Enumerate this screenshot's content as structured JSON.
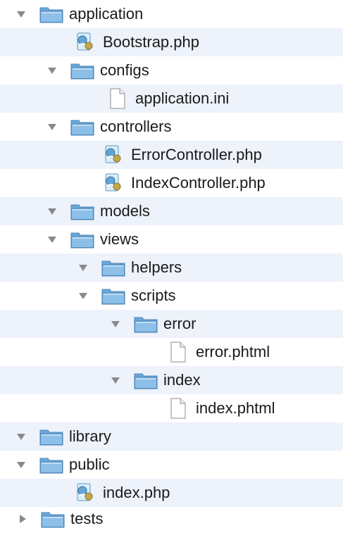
{
  "tree": {
    "rows": [
      {
        "label": "application",
        "type": "folder",
        "expanded": true,
        "depth": 0
      },
      {
        "label": "Bootstrap.php",
        "type": "php",
        "depth": 1
      },
      {
        "label": "configs",
        "type": "folder",
        "expanded": true,
        "depth": 1
      },
      {
        "label": "application.ini",
        "type": "file",
        "depth": 2
      },
      {
        "label": "controllers",
        "type": "folder",
        "expanded": true,
        "depth": 1
      },
      {
        "label": "ErrorController.php",
        "type": "php",
        "depth": 2
      },
      {
        "label": "IndexController.php",
        "type": "php",
        "depth": 2
      },
      {
        "label": "models",
        "type": "folder",
        "expanded": true,
        "depth": 1
      },
      {
        "label": "views",
        "type": "folder",
        "expanded": true,
        "depth": 1
      },
      {
        "label": "helpers",
        "type": "folder",
        "expanded": true,
        "depth": 2
      },
      {
        "label": "scripts",
        "type": "folder",
        "expanded": true,
        "depth": 2
      },
      {
        "label": "error",
        "type": "folder",
        "expanded": true,
        "depth": 3
      },
      {
        "label": "error.phtml",
        "type": "file",
        "depth": 4
      },
      {
        "label": "index",
        "type": "folder",
        "expanded": true,
        "depth": 3
      },
      {
        "label": "index.phtml",
        "type": "file",
        "depth": 4
      },
      {
        "label": "library",
        "type": "folder",
        "expanded": true,
        "depth": 0
      },
      {
        "label": "public",
        "type": "folder",
        "expanded": true,
        "depth": 0
      },
      {
        "label": "index.php",
        "type": "php",
        "depth": 1
      },
      {
        "label": "tests",
        "type": "folder",
        "expanded": false,
        "depth": 0
      }
    ]
  },
  "colors": {
    "alt_row": "#edf2fb",
    "folder": "#7fb4dd",
    "triangle": "#8a8a8a"
  }
}
